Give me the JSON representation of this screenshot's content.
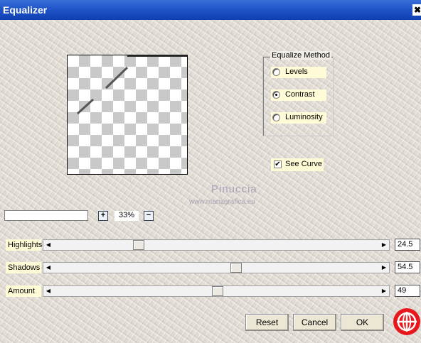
{
  "window": {
    "title": "Equalizer",
    "close_glyph": "✖"
  },
  "method_group": {
    "title": "Equalize Method",
    "options": [
      {
        "label": "Levels",
        "selected": false
      },
      {
        "label": "Contrast",
        "selected": true
      },
      {
        "label": "Luminosity",
        "selected": false
      }
    ]
  },
  "see_curve": {
    "label": "See Curve",
    "checked": true,
    "mark": "✔"
  },
  "watermark": {
    "title": "Pinuccia",
    "url": "www.mariagrafica.eu"
  },
  "zoom": {
    "plus": "+",
    "minus": "−",
    "value": "33%"
  },
  "sliders": [
    {
      "label": "Highlights",
      "value": "24.5",
      "position_fraction": 0.245
    },
    {
      "label": "Shadows",
      "value": "54.5",
      "position_fraction": 0.545
    },
    {
      "label": "Amount",
      "value": "49",
      "position_fraction": 0.49
    }
  ],
  "arrows": {
    "left": "◀",
    "right": "▶"
  },
  "buttons": {
    "reset": "Reset",
    "cancel": "Cancel",
    "ok": "OK"
  },
  "colors": {
    "title_bar": "#1f55c9",
    "label_bg": "#fffbd6",
    "logo": "#e8171c"
  }
}
